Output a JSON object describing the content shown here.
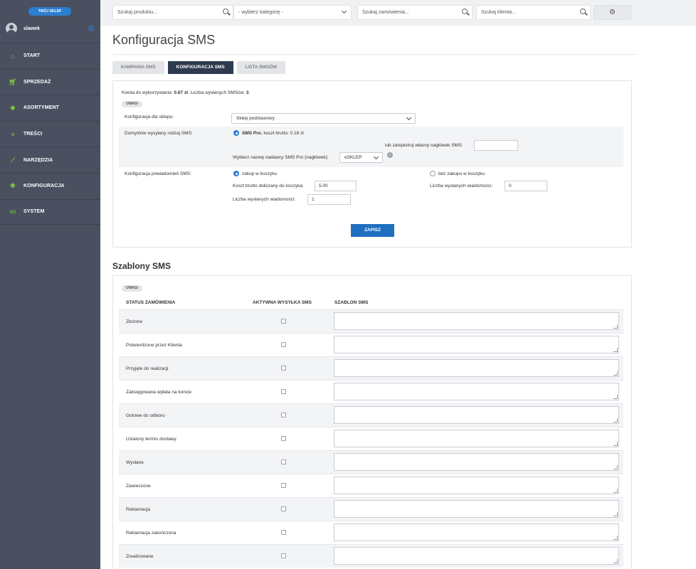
{
  "sidebar": {
    "shop_button": "TWÓJ SKLEP",
    "username": "slawek",
    "items": [
      {
        "label": "START",
        "icon": "home-icon"
      },
      {
        "label": "SPRZEDAŻ",
        "icon": "cart-icon"
      },
      {
        "label": "ASORTYMENT",
        "icon": "tag-icon"
      },
      {
        "label": "TREŚCI",
        "icon": "list-icon"
      },
      {
        "label": "NARZĘDZIA",
        "icon": "chart-icon"
      },
      {
        "label": "KONFIGURACJA",
        "icon": "gear-icon"
      },
      {
        "label": "SYSTEM",
        "icon": "monitor-icon"
      }
    ],
    "accent_color": "#7ac143",
    "bg_color": "#4a5060"
  },
  "topbar": {
    "search_product_placeholder": "Szukaj produktu...",
    "category_select": "- wybierz kategorię -",
    "search_orders_placeholder": "Szukaj zamówienia...",
    "search_client_placeholder": "Szukaj klienta..."
  },
  "page": {
    "title": "Konfiguracja SMS",
    "tabs": [
      {
        "label": "KAMPANIA SMS",
        "active": false
      },
      {
        "label": "KONFIGURACJA SMS",
        "active": true
      },
      {
        "label": "LISTA SMSÓW",
        "active": false
      }
    ]
  },
  "config": {
    "balance_prefix": "Kwota do wykorzystania:",
    "balance_value": "0.67 zł",
    "sent_prefix": ". Liczba wysłanych SMSów:",
    "sent_value": "3",
    "sent_suffix": ".",
    "notes_pill": "UWAGI",
    "shop_config_label": "Konfiguracja dla sklepu:",
    "shop_config_value": "Sklep podstawowy",
    "default_type_label": "Domyślnie wysyłany rodzaj SMS:",
    "sms_pro_name": "SMS Pro",
    "sms_pro_cost": ", koszt brutto: 0.18 zł",
    "own_header_label": "lub zarejestruj własny nagłówek SMS:",
    "own_header_value": "",
    "sender_label": "Wybierz nazwę nadawcy SMS Pro (nagłówek):",
    "sender_value": "eSKLEP",
    "notif_label": "Konfiguracja powiadomień SMS:",
    "option_cart": "zakup w koszyku",
    "option_no_cart": "bez zakupu w koszyku",
    "cart_cost_label": "Koszt brutto doliczany do koszyka:",
    "cart_cost_value": "5.00",
    "sent_count_label": "Liczba wysłanych wiadomości:",
    "sent_count_cart_value": "1",
    "sent_count_nocart_value": "0",
    "save_button": "ZAPISZ",
    "save_color": "#1f6fbf"
  },
  "templates": {
    "section_title": "Szablony SMS",
    "notes_pill": "UWAGI",
    "headers": {
      "status": "STATUS ZAMÓWIENIA",
      "active": "AKTYWNA WYSYŁKA SMS",
      "template": "SZABLON SMS"
    },
    "rows": [
      {
        "status": "Złożone",
        "active": false,
        "template": ""
      },
      {
        "status": "Potwierdzone przez Klienta",
        "active": false,
        "template": ""
      },
      {
        "status": "Przyjęte do realizacji",
        "active": false,
        "template": ""
      },
      {
        "status": "Zaksięgowana wpłata na koncie",
        "active": false,
        "template": ""
      },
      {
        "status": "Gotowe do odbioru",
        "active": false,
        "template": ""
      },
      {
        "status": "Ustalony termin dostawy",
        "active": false,
        "template": ""
      },
      {
        "status": "Wysłane",
        "active": false,
        "template": ""
      },
      {
        "status": "Zawieszone",
        "active": false,
        "template": ""
      },
      {
        "status": "Reklamacja",
        "active": false,
        "template": ""
      },
      {
        "status": "Reklamacja zakończona",
        "active": false,
        "template": ""
      },
      {
        "status": "Zrealizowane",
        "active": false,
        "template": ""
      }
    ]
  }
}
